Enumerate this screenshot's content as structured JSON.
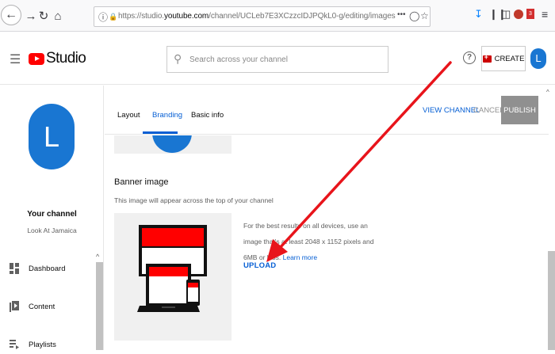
{
  "browser": {
    "url_prefix": "https://studio.",
    "url_domain": "youtube.com",
    "url_path": "/channel/UCLeb7E3XCzzcIDJPQkL0-g/editing/images",
    "toolbar_more": "•••",
    "notification_count": "3"
  },
  "header": {
    "logo_text": "Studio",
    "search_placeholder": "Search across your channel",
    "help_label": "?",
    "create_label": "CREATE",
    "avatar_letter": "L"
  },
  "sidebar": {
    "avatar_letter": "L",
    "channel_title": "Your channel",
    "channel_name": "Look At Jamaica",
    "items": [
      {
        "label": "Dashboard",
        "icon": "dashboard-icon"
      },
      {
        "label": "Content",
        "icon": "content-icon"
      },
      {
        "label": "Playlists",
        "icon": "playlists-icon"
      }
    ]
  },
  "main": {
    "tabs": [
      {
        "label": "Layout"
      },
      {
        "label": "Branding"
      },
      {
        "label": "Basic info"
      }
    ],
    "active_tab": "Branding",
    "view_channel_label": "VIEW CHANNEL",
    "cancel_label": "CANCEL",
    "publish_label": "PUBLISH",
    "banner": {
      "title": "Banner image",
      "description": "This image will appear across the top of your channel",
      "info_text": "For the best results on all devices, use an image that's at least 2048 x 1152 pixels and 6MB or less.",
      "learn_more_label": "Learn more",
      "upload_label": "UPLOAD"
    }
  },
  "colors": {
    "accent": "#065fd4",
    "brand_red": "#ff0000",
    "avatar_blue": "#1976d2",
    "annotation_red": "#e8141b"
  }
}
